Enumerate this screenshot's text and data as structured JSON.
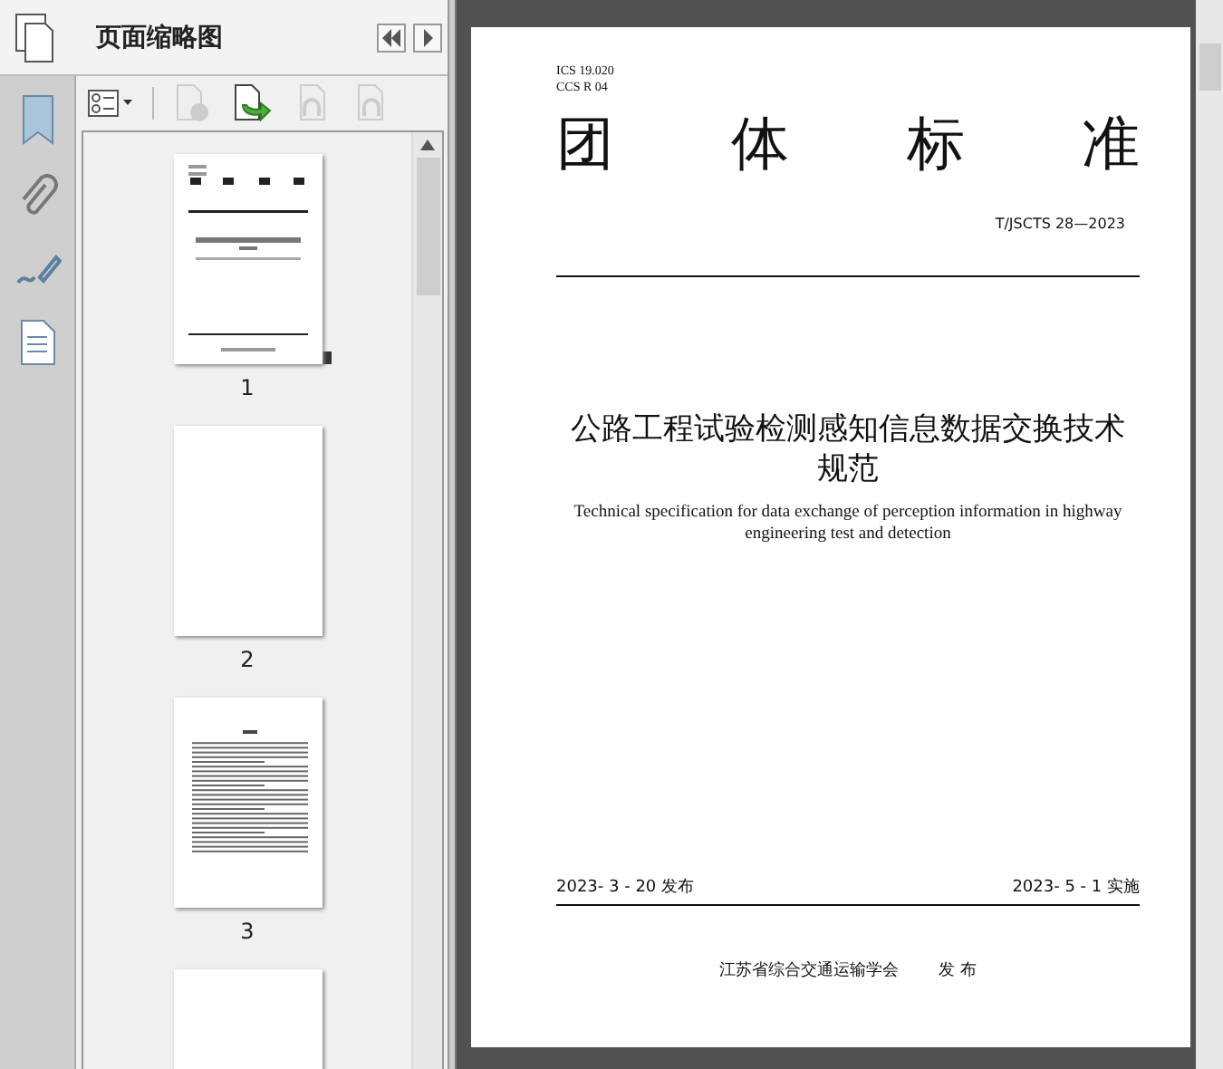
{
  "panel": {
    "title": "页面缩略图"
  },
  "thumbnails": [
    {
      "label": "1",
      "kind": "cover",
      "selected": true
    },
    {
      "label": "2",
      "kind": "blank",
      "selected": false
    },
    {
      "label": "3",
      "kind": "contents",
      "selected": false
    },
    {
      "kind": "blank"
    }
  ],
  "page": {
    "ics": "ICS  19.020",
    "ccs": "CCS R 04",
    "heading": [
      "团",
      "体",
      "标",
      "准"
    ],
    "code": "T/JSCTS 28—2023",
    "title_zh": "公路工程试验检测感知信息数据交换技术规范",
    "title_en": "Technical specification for data exchange of perception information in highway engineering test and detection",
    "issue_date": "2023- 3 - 20 发布",
    "effective_date": "2023- 5 - 1 实施",
    "publisher": "江苏省综合交通运输学会",
    "publish_word": "发  布"
  }
}
